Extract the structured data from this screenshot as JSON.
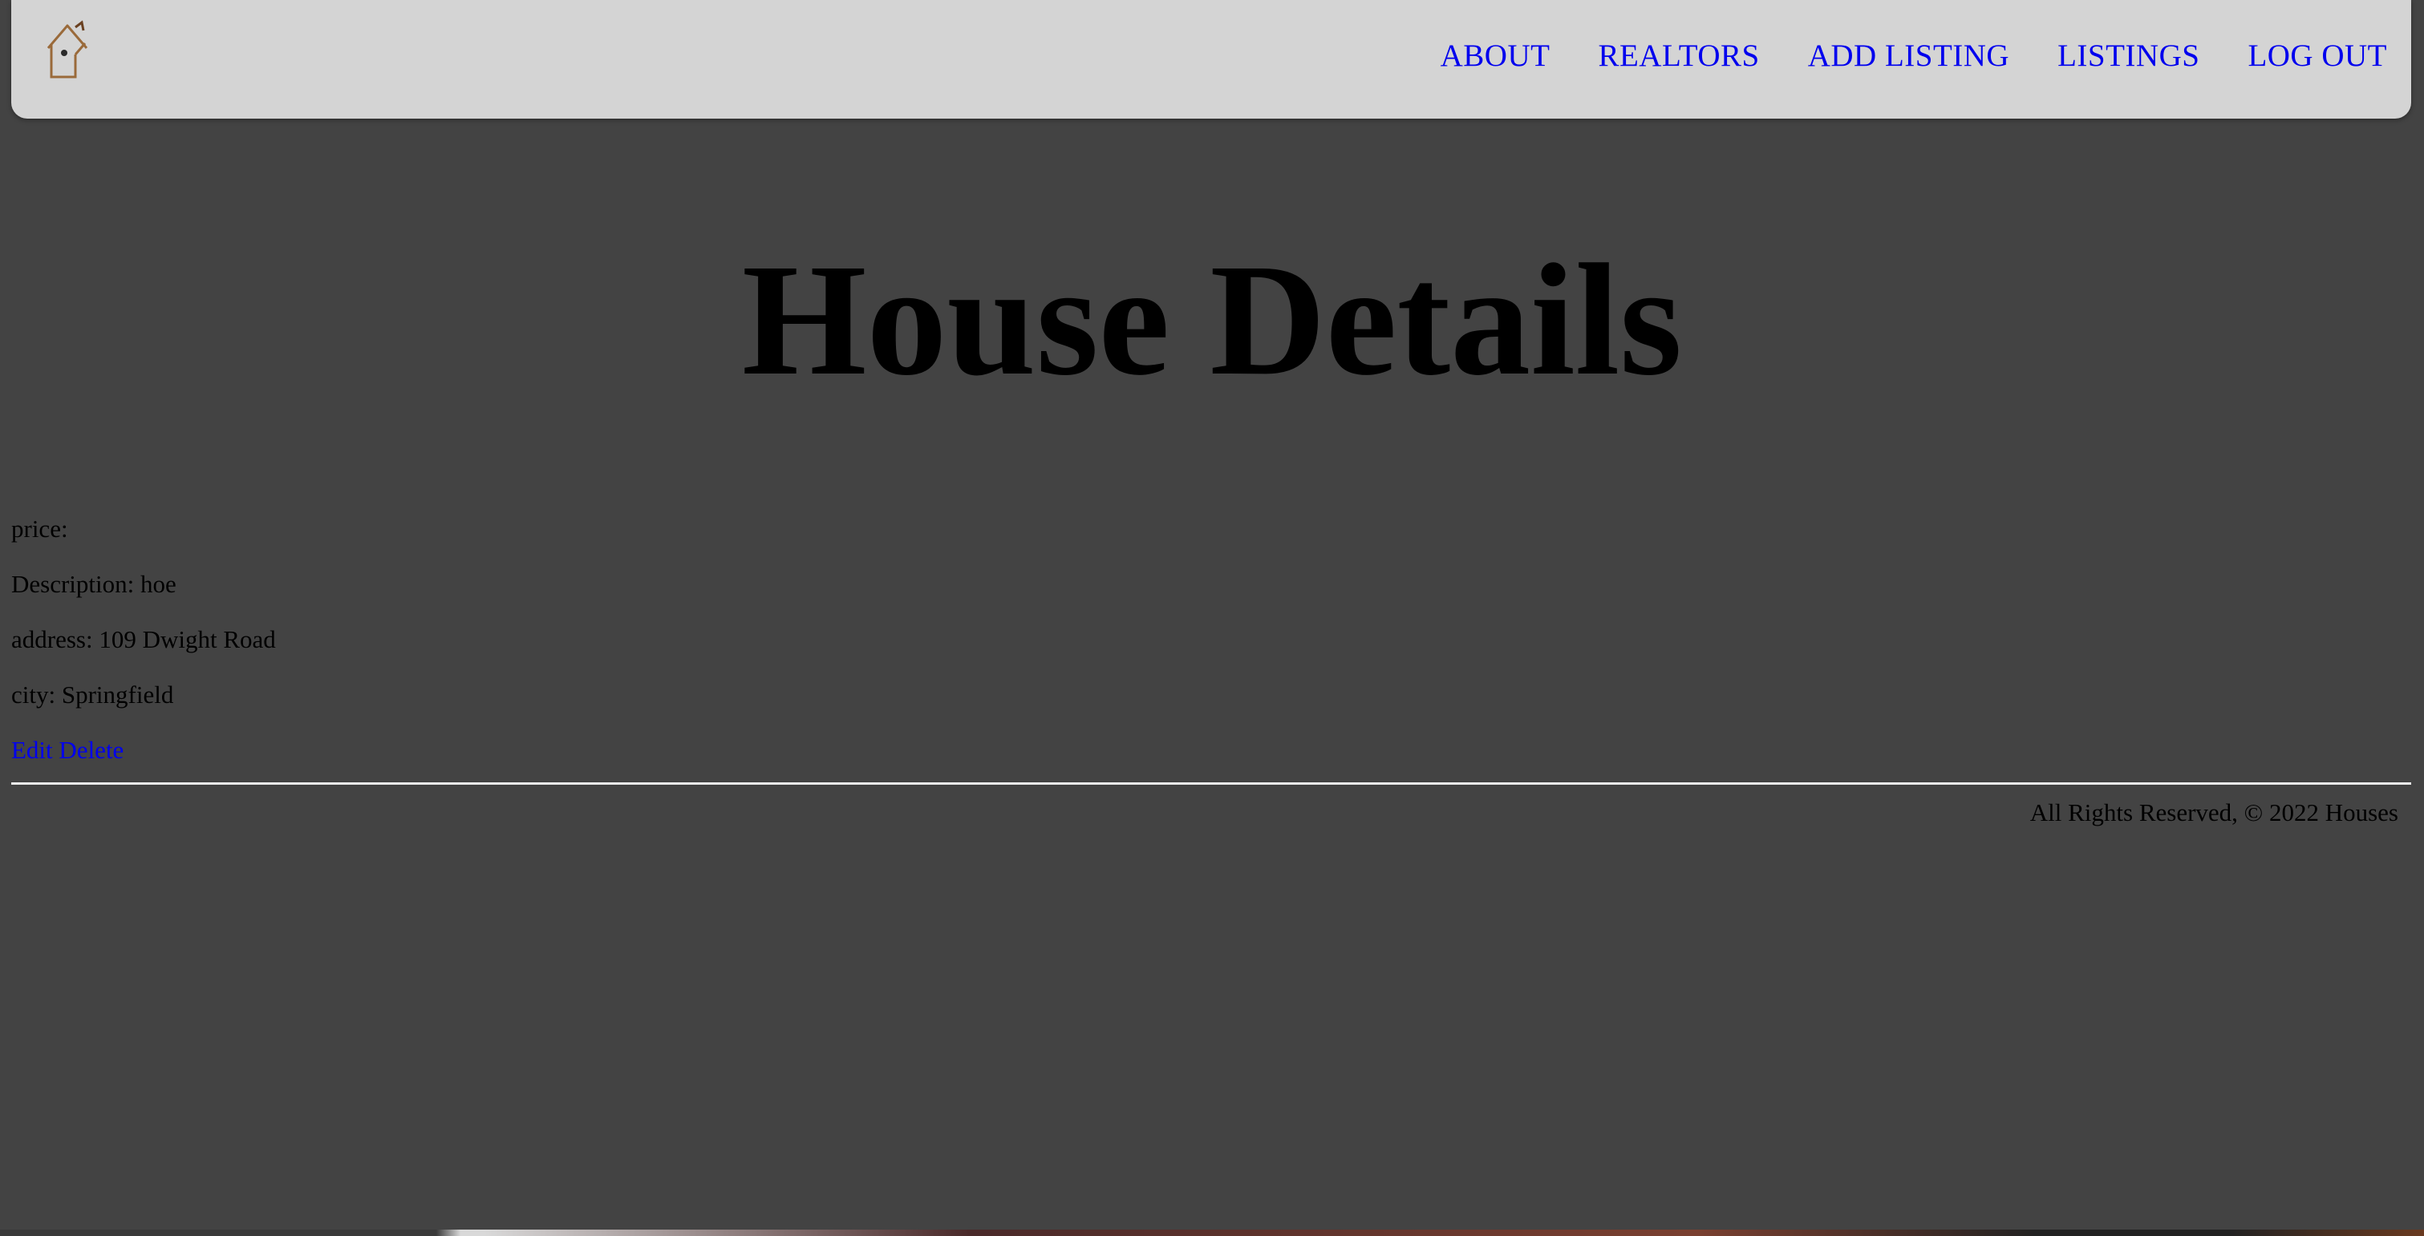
{
  "navbar": {
    "logo_icon": "birdhouse-logo-icon",
    "links": [
      {
        "label": "ABOUT"
      },
      {
        "label": "REALTORS"
      },
      {
        "label": "ADD LISTING"
      },
      {
        "label": "LISTINGS"
      },
      {
        "label": "LOG OUT"
      }
    ]
  },
  "page": {
    "title": "House Details"
  },
  "details": {
    "price": "price:",
    "description": "Description: hoe",
    "address": "address: 109 Dwight Road",
    "city": "city: Springfield"
  },
  "actions": {
    "edit_label": "Edit",
    "delete_label": "Delete"
  },
  "footer": {
    "text": "All Rights Reserved, © 2022 Houses"
  },
  "colors": {
    "background": "#434343",
    "navbar": "#d4d4d4",
    "link": "#0000ee",
    "divider": "#ececec"
  }
}
